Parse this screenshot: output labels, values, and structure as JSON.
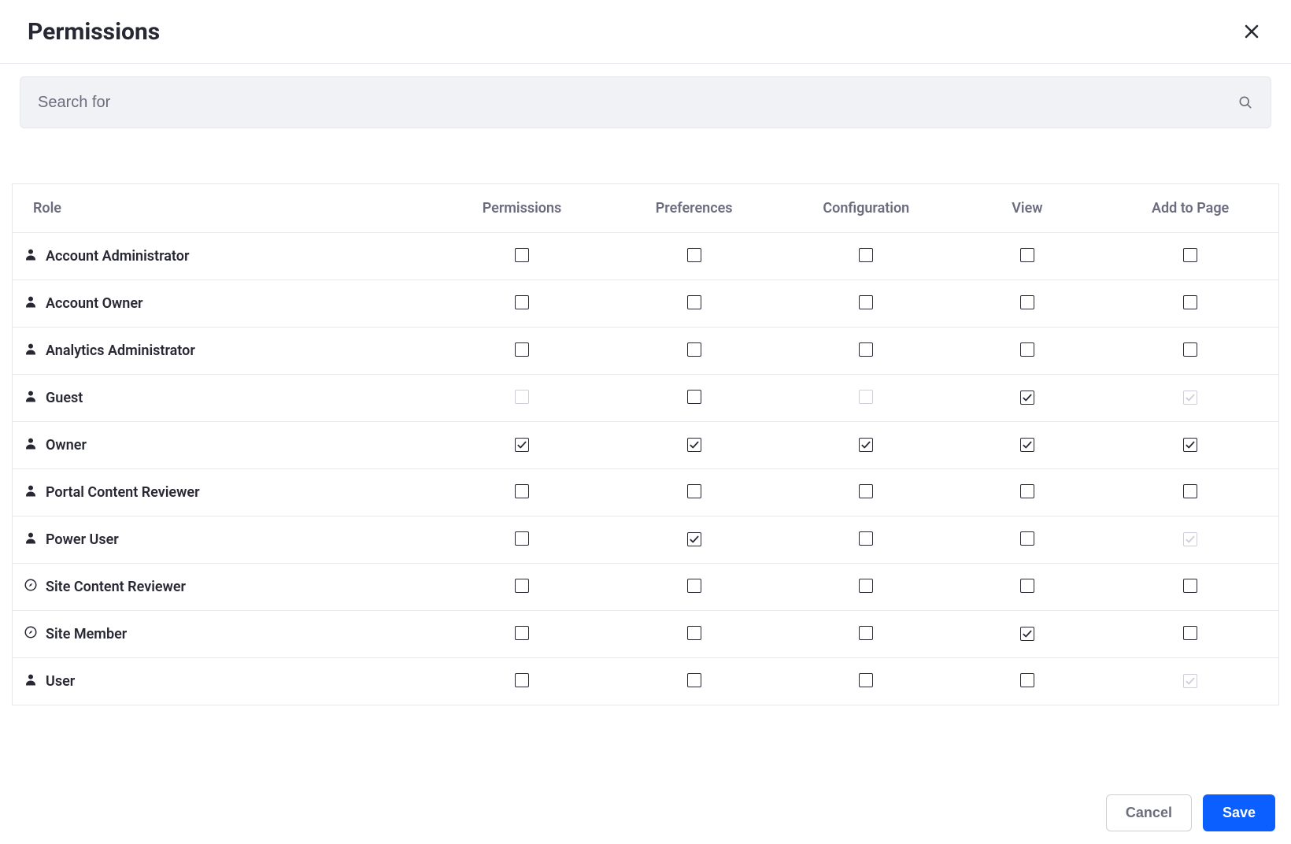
{
  "header": {
    "title": "Permissions"
  },
  "search": {
    "placeholder": "Search for"
  },
  "columns": [
    {
      "key": "role",
      "label": "Role"
    },
    {
      "key": "permissions",
      "label": "Permissions"
    },
    {
      "key": "preferences",
      "label": "Preferences"
    },
    {
      "key": "configuration",
      "label": "Configuration"
    },
    {
      "key": "view",
      "label": "View"
    },
    {
      "key": "add_to_page",
      "label": "Add to Page"
    }
  ],
  "roles": [
    {
      "name": "Account Administrator",
      "icon": "user",
      "permissions": {
        "checked": false,
        "enabled": true
      },
      "preferences": {
        "checked": false,
        "enabled": true
      },
      "configuration": {
        "checked": false,
        "enabled": true
      },
      "view": {
        "checked": false,
        "enabled": true
      },
      "add_to_page": {
        "checked": false,
        "enabled": true
      }
    },
    {
      "name": "Account Owner",
      "icon": "user",
      "permissions": {
        "checked": false,
        "enabled": true
      },
      "preferences": {
        "checked": false,
        "enabled": true
      },
      "configuration": {
        "checked": false,
        "enabled": true
      },
      "view": {
        "checked": false,
        "enabled": true
      },
      "add_to_page": {
        "checked": false,
        "enabled": true
      }
    },
    {
      "name": "Analytics Administrator",
      "icon": "user",
      "permissions": {
        "checked": false,
        "enabled": true
      },
      "preferences": {
        "checked": false,
        "enabled": true
      },
      "configuration": {
        "checked": false,
        "enabled": true
      },
      "view": {
        "checked": false,
        "enabled": true
      },
      "add_to_page": {
        "checked": false,
        "enabled": true
      }
    },
    {
      "name": "Guest",
      "icon": "user",
      "permissions": {
        "checked": false,
        "enabled": false
      },
      "preferences": {
        "checked": false,
        "enabled": true
      },
      "configuration": {
        "checked": false,
        "enabled": false
      },
      "view": {
        "checked": true,
        "enabled": true
      },
      "add_to_page": {
        "checked": true,
        "enabled": false
      }
    },
    {
      "name": "Owner",
      "icon": "user",
      "permissions": {
        "checked": true,
        "enabled": true
      },
      "preferences": {
        "checked": true,
        "enabled": true
      },
      "configuration": {
        "checked": true,
        "enabled": true
      },
      "view": {
        "checked": true,
        "enabled": true
      },
      "add_to_page": {
        "checked": true,
        "enabled": true
      }
    },
    {
      "name": "Portal Content Reviewer",
      "icon": "user",
      "permissions": {
        "checked": false,
        "enabled": true
      },
      "preferences": {
        "checked": false,
        "enabled": true
      },
      "configuration": {
        "checked": false,
        "enabled": true
      },
      "view": {
        "checked": false,
        "enabled": true
      },
      "add_to_page": {
        "checked": false,
        "enabled": true
      }
    },
    {
      "name": "Power User",
      "icon": "user",
      "permissions": {
        "checked": false,
        "enabled": true
      },
      "preferences": {
        "checked": true,
        "enabled": true
      },
      "configuration": {
        "checked": false,
        "enabled": true
      },
      "view": {
        "checked": false,
        "enabled": true
      },
      "add_to_page": {
        "checked": true,
        "enabled": false
      }
    },
    {
      "name": "Site Content Reviewer",
      "icon": "compass",
      "permissions": {
        "checked": false,
        "enabled": true
      },
      "preferences": {
        "checked": false,
        "enabled": true
      },
      "configuration": {
        "checked": false,
        "enabled": true
      },
      "view": {
        "checked": false,
        "enabled": true
      },
      "add_to_page": {
        "checked": false,
        "enabled": true
      }
    },
    {
      "name": "Site Member",
      "icon": "compass",
      "permissions": {
        "checked": false,
        "enabled": true
      },
      "preferences": {
        "checked": false,
        "enabled": true
      },
      "configuration": {
        "checked": false,
        "enabled": true
      },
      "view": {
        "checked": true,
        "enabled": true
      },
      "add_to_page": {
        "checked": false,
        "enabled": true
      }
    },
    {
      "name": "User",
      "icon": "user",
      "permissions": {
        "checked": false,
        "enabled": true
      },
      "preferences": {
        "checked": false,
        "enabled": true
      },
      "configuration": {
        "checked": false,
        "enabled": true
      },
      "view": {
        "checked": false,
        "enabled": true
      },
      "add_to_page": {
        "checked": true,
        "enabled": false
      }
    }
  ],
  "footer": {
    "cancel": "Cancel",
    "save": "Save"
  }
}
